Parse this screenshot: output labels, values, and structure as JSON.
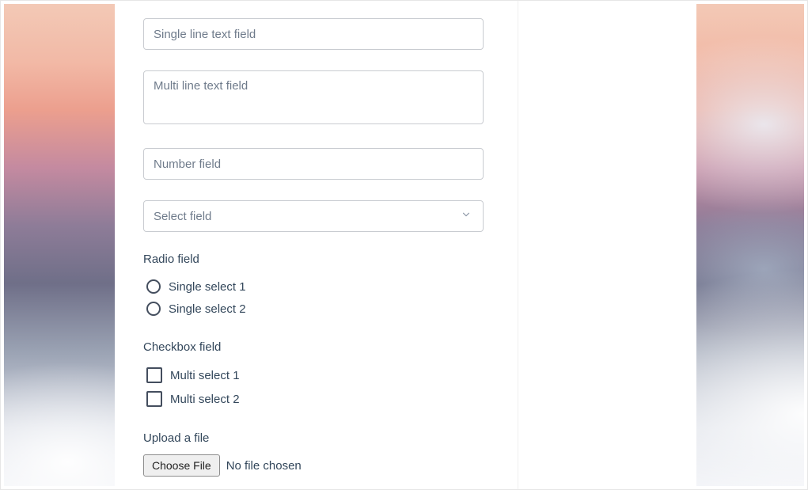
{
  "form": {
    "single_line_placeholder": "Single line text field",
    "multi_line_placeholder": "Multi line text field",
    "number_placeholder": "Number field",
    "select_placeholder": "Select field",
    "radio": {
      "label": "Radio field",
      "options": [
        "Single select 1",
        "Single select 2"
      ]
    },
    "checkbox": {
      "label": "Checkbox field",
      "options": [
        "Multi select 1",
        "Multi select 2"
      ]
    },
    "file": {
      "label": "Upload a file",
      "button": "Choose File",
      "status": "No file chosen"
    }
  }
}
